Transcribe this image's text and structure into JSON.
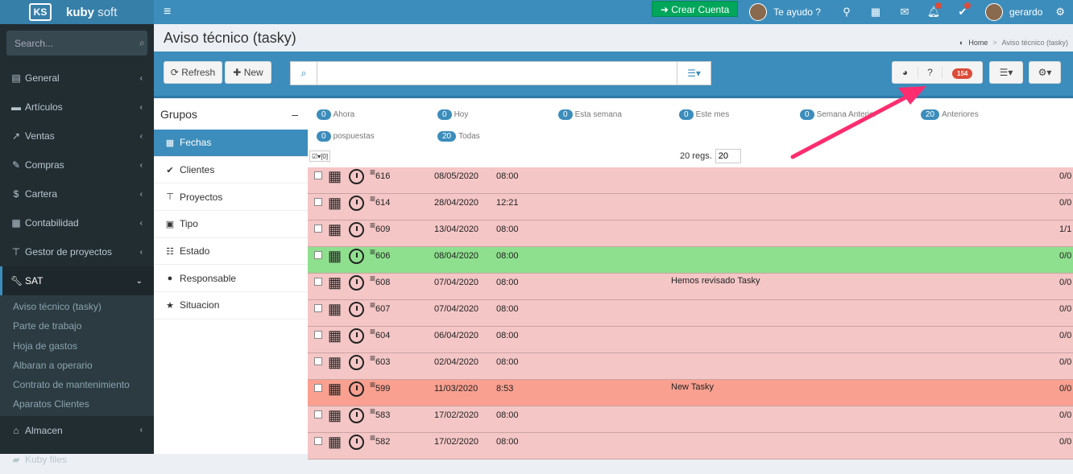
{
  "brand": {
    "logo": "KS",
    "name_bold": "kuby",
    "name_light": "soft"
  },
  "topbar": {
    "create_account": "Crear Cuenta",
    "help": "Te ayudo ?",
    "user": "gerardo"
  },
  "sidebar": {
    "search_placeholder": "Search...",
    "items": [
      {
        "label": "General",
        "icon": "newspaper-icon"
      },
      {
        "label": "Artículos",
        "icon": "archive-icon"
      },
      {
        "label": "Ventas",
        "icon": "external-link-icon"
      },
      {
        "label": "Compras",
        "icon": "edit-icon"
      },
      {
        "label": "Cartera",
        "icon": "dollar-icon"
      },
      {
        "label": "Contabilidad",
        "icon": "calculator-icon"
      },
      {
        "label": "Gestor de proyectos",
        "icon": "sitemap-icon"
      },
      {
        "label": "SAT",
        "icon": "wrench-icon"
      }
    ],
    "sat_sub": [
      "Aviso técnico (tasky)",
      "Parte de trabajo",
      "Hoja de gastos",
      "Albaran a operario",
      "Contrato de mantenimiento",
      "Aparatos Clientes"
    ],
    "after": [
      {
        "label": "Almacen"
      },
      {
        "label": "Kuby files"
      }
    ]
  },
  "page": {
    "title": "Aviso técnico (tasky)",
    "breadcrumb_home": "Home",
    "breadcrumb_current": "Aviso técnico (tasky)"
  },
  "toolbar": {
    "refresh": "Refresh",
    "new": "New",
    "count_badge": "154"
  },
  "groups": {
    "title": "Grupos",
    "collapse": "–",
    "items": [
      "Fechas",
      "Clientes",
      "Proyectos",
      "Tipo",
      "Estado",
      "Responsable",
      "Situacion"
    ]
  },
  "filters": [
    {
      "n": "0",
      "label": "Ahora"
    },
    {
      "n": "0",
      "label": "Hoy"
    },
    {
      "n": "0",
      "label": "Esta semana"
    },
    {
      "n": "0",
      "label": "Este mes"
    },
    {
      "n": "0",
      "label": "Semana Anterior"
    },
    {
      "n": "20",
      "label": "Anteriores"
    },
    {
      "n": "0",
      "label": "pospuestas"
    },
    {
      "n": "20",
      "label": "Todas"
    }
  ],
  "regs": {
    "label": "20 regs.",
    "value": "20"
  },
  "select_all": "▾[0]",
  "row_colors": {
    "pink": "#f5c6c6",
    "green": "#8ee08e",
    "salmon": "#f9a090"
  },
  "rows": [
    {
      "num": "616",
      "date": "08/05/2020",
      "time": "08:00",
      "desc": "",
      "ratio": "0/0",
      "color": "pink"
    },
    {
      "num": "614",
      "date": "28/04/2020",
      "time": "12:21",
      "desc": "",
      "ratio": "0/0",
      "color": "pink"
    },
    {
      "num": "609",
      "date": "13/04/2020",
      "time": "08:00",
      "desc": "",
      "ratio": "1/1",
      "color": "pink"
    },
    {
      "num": "606",
      "date": "08/04/2020",
      "time": "08:00",
      "desc": "",
      "ratio": "0/0",
      "color": "green"
    },
    {
      "num": "608",
      "date": "07/04/2020",
      "time": "08:00",
      "desc": "Hemos revisado Tasky",
      "ratio": "0/0",
      "color": "pink"
    },
    {
      "num": "607",
      "date": "07/04/2020",
      "time": "08:00",
      "desc": "",
      "ratio": "0/0",
      "color": "pink"
    },
    {
      "num": "604",
      "date": "06/04/2020",
      "time": "08:00",
      "desc": "",
      "ratio": "0/0",
      "color": "pink"
    },
    {
      "num": "603",
      "date": "02/04/2020",
      "time": "08:00",
      "desc": "",
      "ratio": "0/0",
      "color": "pink"
    },
    {
      "num": "599",
      "date": "11/03/2020",
      "time": "8:53",
      "desc": "New Tasky",
      "ratio": "0/0",
      "color": "salmon"
    },
    {
      "num": "583",
      "date": "17/02/2020",
      "time": "08:00",
      "desc": "",
      "ratio": "0/0",
      "color": "pink"
    },
    {
      "num": "582",
      "date": "17/02/2020",
      "time": "08:00",
      "desc": "",
      "ratio": "0/0",
      "color": "pink"
    }
  ]
}
